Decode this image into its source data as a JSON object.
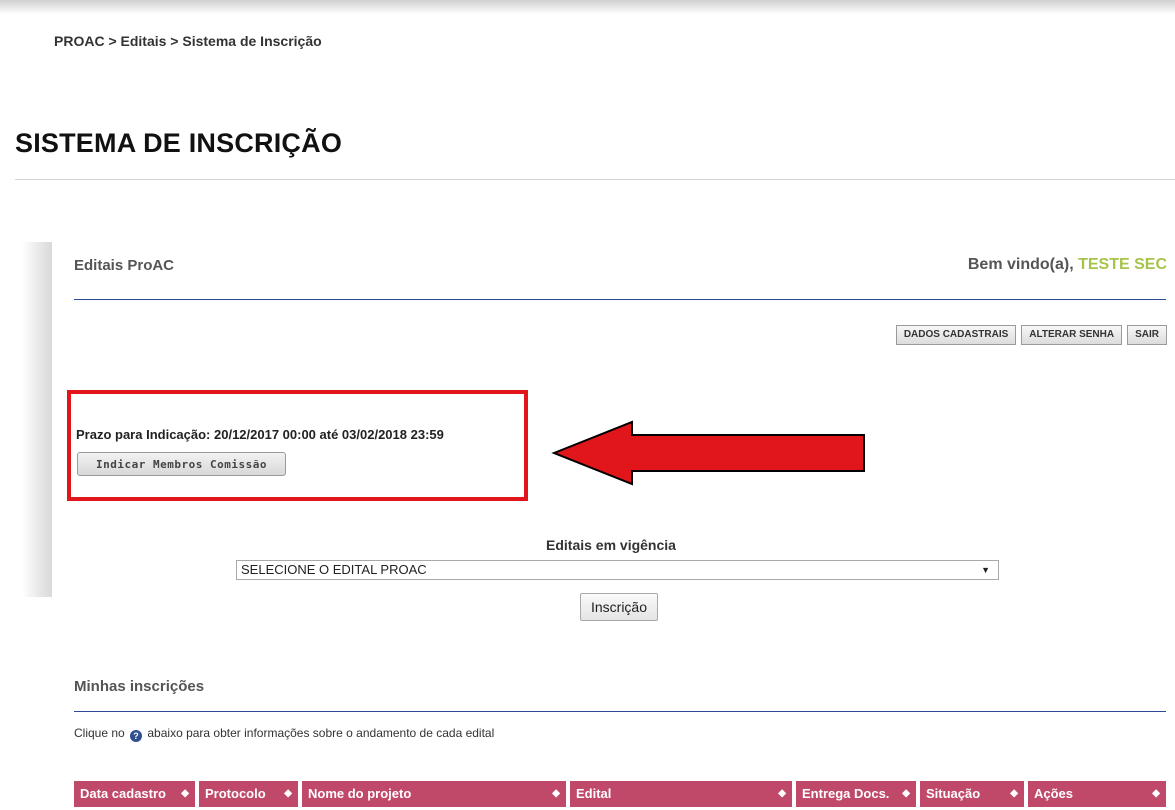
{
  "breadcrumb": "PROAC > Editais > Sistema de Inscrição",
  "page_title": "SISTEMA DE INSCRIÇÃO",
  "section_title": "Editais ProAC",
  "welcome": {
    "prefix": "Bem vindo(a), ",
    "user": "TESTE SEC"
  },
  "account_buttons": {
    "dados": "DADOS CADASTRAIS",
    "senha": "ALTERAR SENHA",
    "sair": "SAIR"
  },
  "prazo": "Prazo para Indicação: 20/12/2017 00:00 até 03/02/2018 23:59",
  "indicar_button": "Indicar Membros Comissão",
  "vigencia_label": "Editais em vigência",
  "edital_select": {
    "selected": "SELECIONE O EDITAL PROAC"
  },
  "inscricao_button": "Inscrição",
  "minhas_title": "Minhas inscrições",
  "info_text": {
    "before": "Clique no ",
    "after": " abaixo para obter informações sobre o andamento de cada edital"
  },
  "table": {
    "columns": [
      "Data cadastro",
      "Protocolo",
      "Nome do projeto",
      "Edital",
      "Entrega Docs.",
      "Situação",
      "Ações"
    ]
  },
  "colors": {
    "header_bg": "#c0496a",
    "highlight": "#e0161b",
    "welcome_user": "#a6c44a",
    "rule": "#2b4a9a"
  }
}
